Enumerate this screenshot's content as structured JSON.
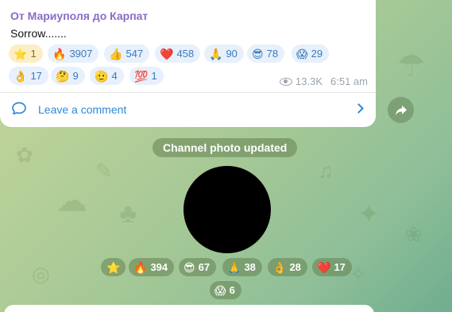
{
  "post": {
    "channel_name": "От Мариуполя до Карпат",
    "text": "Sorrow.......",
    "reactions": [
      {
        "emoji": "⭐",
        "count": "1"
      },
      {
        "emoji": "🔥",
        "count": "3907"
      },
      {
        "emoji": "👍",
        "count": "547"
      },
      {
        "emoji": "❤️",
        "count": "458"
      },
      {
        "emoji": "🙏",
        "count": "90"
      },
      {
        "emoji": "😎",
        "count": "78"
      },
      {
        "emoji": "😱",
        "count": "29"
      },
      {
        "emoji": "👌",
        "count": "17"
      },
      {
        "emoji": "🤔",
        "count": "9"
      },
      {
        "emoji": "🫡",
        "count": "4"
      },
      {
        "emoji": "💯",
        "count": "1"
      }
    ],
    "views": "13.3K",
    "time": "6:51 am",
    "comment_label": "Leave a comment"
  },
  "service_message": "Channel photo updated",
  "photo_reactions": [
    {
      "emoji": "⭐",
      "count": ""
    },
    {
      "emoji": "🔥",
      "count": "394"
    },
    {
      "emoji": "😎",
      "count": "67"
    },
    {
      "emoji": "🙏",
      "count": "38"
    },
    {
      "emoji": "👌",
      "count": "28"
    },
    {
      "emoji": "❤️",
      "count": "17"
    },
    {
      "emoji": "😱",
      "count": "6"
    }
  ],
  "colors": {
    "channel_name": "#8a6bc7",
    "link": "#2f87d6",
    "reaction_bg": "#e7f0fb",
    "paid_reaction_bg": "#fbeec6"
  },
  "icons": {
    "views": "eye-icon",
    "comment": "comment-bubble-icon",
    "open_comments": "chevron-right-icon",
    "share": "share-arrow-icon"
  }
}
